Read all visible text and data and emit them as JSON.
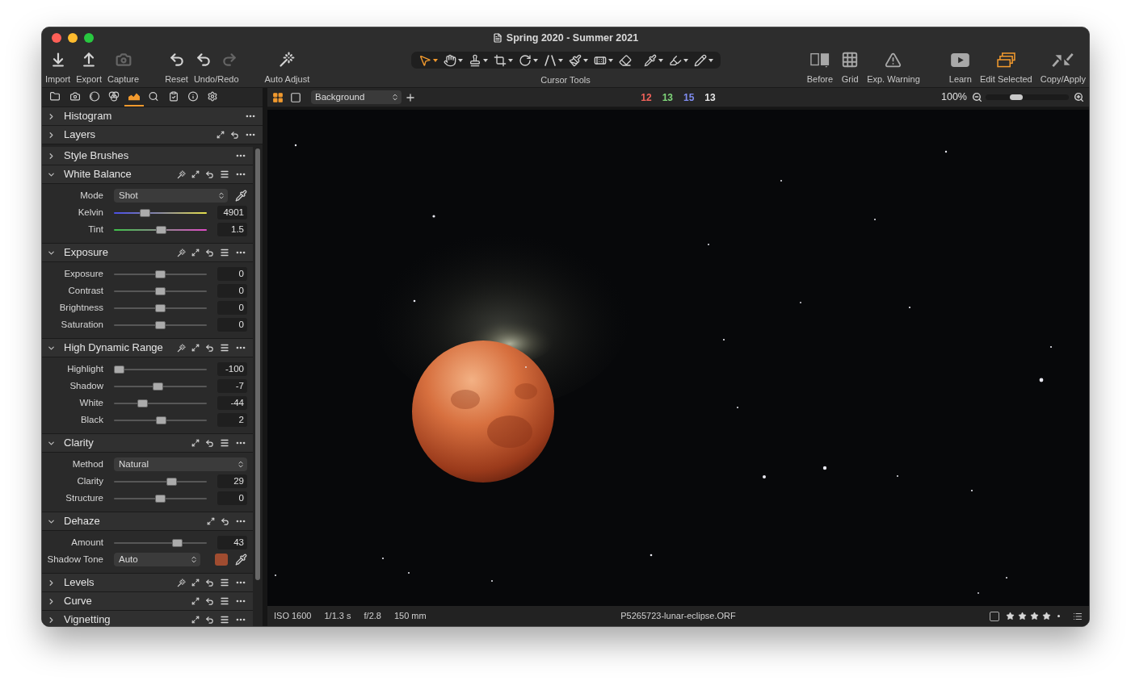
{
  "window": {
    "title": "Spring 2020 - Summer 2021"
  },
  "toolbar": {
    "left_groups": [
      [
        {
          "label": "Import",
          "icons": [
            {
              "kind": "import",
              "disabled": false
            }
          ]
        },
        {
          "label": "Export",
          "icons": [
            {
              "kind": "export",
              "disabled": false
            }
          ]
        },
        {
          "label": "Capture",
          "icons": [
            {
              "kind": "camera",
              "disabled": true
            }
          ]
        }
      ],
      [
        {
          "label": "Reset",
          "icons": [
            {
              "kind": "reset",
              "disabled": false
            }
          ]
        },
        {
          "label": "Undo/Redo",
          "icons": [
            {
              "kind": "undo",
              "disabled": false
            },
            {
              "kind": "redo",
              "disabled": true
            }
          ]
        }
      ],
      [
        {
          "label": "Auto Adjust",
          "icons": [
            {
              "kind": "wand",
              "disabled": false
            }
          ]
        }
      ]
    ],
    "cursor_tools": {
      "label": "Cursor Tools",
      "tools": [
        {
          "kind": "pointer",
          "selected": true,
          "menu": true
        },
        {
          "kind": "hand",
          "selected": false,
          "menu": true
        },
        {
          "kind": "stamp",
          "selected": false,
          "menu": true
        },
        {
          "kind": "crop",
          "selected": false,
          "menu": true
        },
        {
          "kind": "rotate",
          "selected": false,
          "menu": true
        },
        {
          "kind": "keystone",
          "selected": false,
          "menu": true
        },
        {
          "kind": "brush",
          "selected": false,
          "menu": true
        },
        {
          "kind": "heal",
          "selected": false,
          "menu": true
        },
        {
          "kind": "eraser",
          "selected": false,
          "menu": false
        },
        {
          "kind": "picker",
          "selected": false,
          "menu": true
        },
        {
          "kind": "marker",
          "selected": false,
          "menu": true
        },
        {
          "kind": "pencil",
          "selected": false,
          "menu": true
        }
      ]
    },
    "right_groups": [
      [
        {
          "label": "Before",
          "kind": "before",
          "active": false
        },
        {
          "label": "Grid",
          "kind": "grid",
          "active": false
        },
        {
          "label": "Exp. Warning",
          "kind": "warning",
          "active": false
        }
      ],
      [
        {
          "label": "Learn",
          "kind": "learn",
          "active": false
        },
        {
          "label": "Edit Selected",
          "kind": "edit_selected",
          "active": true
        },
        {
          "label": "Copy/Apply",
          "kind": "copy_apply",
          "active": false
        }
      ]
    ]
  },
  "tool_tabs": [
    {
      "kind": "folder",
      "selected": false
    },
    {
      "kind": "camera",
      "selected": false
    },
    {
      "kind": "lens",
      "selected": false
    },
    {
      "kind": "color",
      "selected": false
    },
    {
      "kind": "exposure",
      "selected": true
    },
    {
      "kind": "details",
      "selected": false
    },
    {
      "kind": "clipboard",
      "selected": false
    },
    {
      "kind": "info",
      "selected": false
    },
    {
      "kind": "settings",
      "selected": false
    }
  ],
  "viewer_toolbar": {
    "view_modes": [
      {
        "kind": "grid",
        "selected": true
      },
      {
        "kind": "single",
        "selected": false
      }
    ],
    "layer": {
      "value": "Background"
    },
    "counts": [
      {
        "text": "12",
        "color": "#f0625a"
      },
      {
        "text": "13",
        "color": "#7fd67a"
      },
      {
        "text": "15",
        "color": "#7f8cf0"
      },
      {
        "text": "13",
        "color": "#e6e6e6"
      }
    ],
    "zoom": {
      "text": "100%",
      "level": 0.34
    }
  },
  "panel": {
    "pinned": [
      {
        "title": "Histogram",
        "expanded": false,
        "actions": [
          {
            "kind": "more"
          }
        ]
      },
      {
        "title": "Layers",
        "expanded": false,
        "actions": [
          {
            "kind": "expand"
          },
          {
            "kind": "reset"
          },
          {
            "kind": "more"
          }
        ]
      }
    ],
    "tools": [
      {
        "title": "Style Brushes",
        "expanded": false,
        "actions": [
          {
            "kind": "more"
          }
        ]
      },
      {
        "title": "White Balance",
        "expanded": true,
        "actions": [
          {
            "kind": "wand"
          },
          {
            "kind": "expand"
          },
          {
            "kind": "reset"
          },
          {
            "kind": "menu"
          },
          {
            "kind": "more"
          }
        ],
        "rows": [
          {
            "kind": "select",
            "label": "Mode",
            "value": "Shot",
            "picker": true
          },
          {
            "kind": "temperature",
            "label": "Kelvin",
            "level": 0.31,
            "value": "4901"
          },
          {
            "kind": "tint",
            "label": "Tint",
            "level": 0.51,
            "value": "1.5"
          }
        ]
      },
      {
        "title": "Exposure",
        "expanded": true,
        "actions": [
          {
            "kind": "wand"
          },
          {
            "kind": "expand"
          },
          {
            "kind": "reset"
          },
          {
            "kind": "menu"
          },
          {
            "kind": "more"
          }
        ],
        "rows": [
          {
            "kind": "slider",
            "label": "Exposure",
            "level": 0.5,
            "value": "0"
          },
          {
            "kind": "slider",
            "label": "Contrast",
            "level": 0.5,
            "value": "0"
          },
          {
            "kind": "slider",
            "label": "Brightness",
            "level": 0.5,
            "value": "0"
          },
          {
            "kind": "slider",
            "label": "Saturation",
            "level": 0.5,
            "value": "0"
          }
        ]
      },
      {
        "title": "High Dynamic Range",
        "expanded": true,
        "actions": [
          {
            "kind": "wand"
          },
          {
            "kind": "expand"
          },
          {
            "kind": "reset"
          },
          {
            "kind": "menu"
          },
          {
            "kind": "more"
          }
        ],
        "rows": [
          {
            "kind": "slider",
            "label": "Highlight",
            "level": 0,
            "value": "-100"
          },
          {
            "kind": "slider",
            "label": "Shadow",
            "level": 0.47,
            "value": "-7"
          },
          {
            "kind": "slider",
            "label": "White",
            "level": 0.28,
            "value": "-44"
          },
          {
            "kind": "slider",
            "label": "Black",
            "level": 0.51,
            "value": "2"
          }
        ]
      },
      {
        "title": "Clarity",
        "expanded": true,
        "actions": [
          {
            "kind": "expand"
          },
          {
            "kind": "reset"
          },
          {
            "kind": "menu"
          },
          {
            "kind": "more"
          }
        ],
        "rows": [
          {
            "kind": "select",
            "label": "Method",
            "value": "Natural",
            "picker": false
          },
          {
            "kind": "slider",
            "label": "Clarity",
            "level": 0.64,
            "value": "29"
          },
          {
            "kind": "slider",
            "label": "Structure",
            "level": 0.5,
            "value": "0"
          }
        ]
      },
      {
        "title": "Dehaze",
        "expanded": true,
        "actions": [
          {
            "kind": "expand"
          },
          {
            "kind": "reset"
          },
          {
            "kind": "more"
          }
        ],
        "rows": [
          {
            "kind": "slider",
            "label": "Amount",
            "level": 0.71,
            "value": "43"
          },
          {
            "kind": "select",
            "label": "Shadow Tone",
            "value": "Auto",
            "color": "#a04c30",
            "picker": true
          }
        ]
      },
      {
        "title": "Levels",
        "expanded": false,
        "actions": [
          {
            "kind": "wand"
          },
          {
            "kind": "expand"
          },
          {
            "kind": "reset"
          },
          {
            "kind": "menu"
          },
          {
            "kind": "more"
          }
        ]
      },
      {
        "title": "Curve",
        "expanded": false,
        "actions": [
          {
            "kind": "expand"
          },
          {
            "kind": "reset"
          },
          {
            "kind": "menu"
          },
          {
            "kind": "more"
          }
        ]
      },
      {
        "title": "Vignetting",
        "expanded": false,
        "actions": [
          {
            "kind": "expand"
          },
          {
            "kind": "reset"
          },
          {
            "kind": "menu"
          },
          {
            "kind": "more"
          }
        ]
      }
    ]
  },
  "status_bar": {
    "info": [
      "ISO 1600",
      "1/1.3 s",
      "f/2.8",
      "150 mm"
    ],
    "filename": "P5265723-lunar-eclipse.ORF",
    "checked": false,
    "stars": 4
  }
}
